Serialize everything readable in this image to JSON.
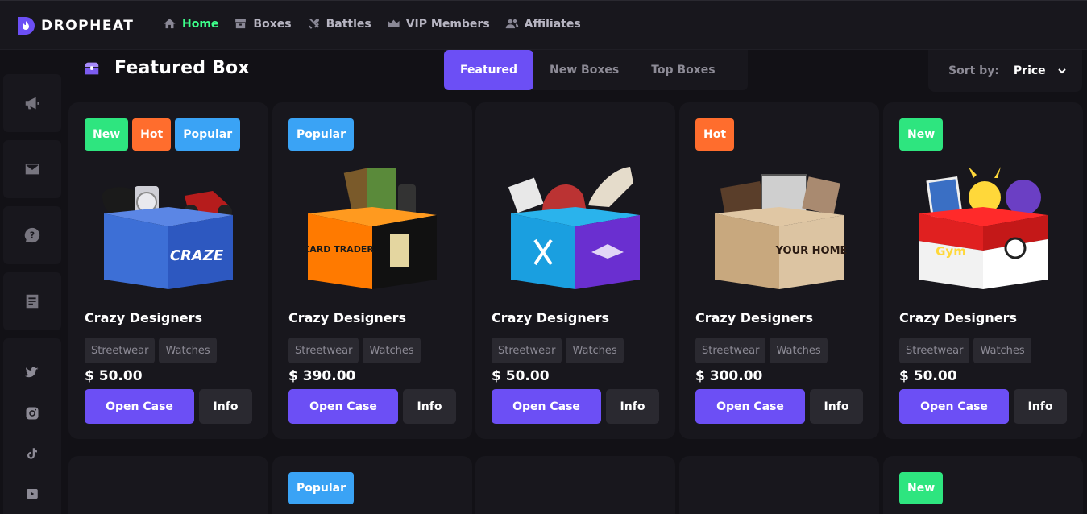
{
  "brand": {
    "name": "DROPHEAT"
  },
  "nav": [
    {
      "label": "Home",
      "icon": "home-icon",
      "active": true
    },
    {
      "label": "Boxes",
      "icon": "boxes-icon",
      "active": false
    },
    {
      "label": "Battles",
      "icon": "swords-icon",
      "active": false
    },
    {
      "label": "VIP Members",
      "icon": "crown-icon",
      "active": false
    },
    {
      "label": "Affiliates",
      "icon": "users-icon",
      "active": false
    }
  ],
  "sidebar": {
    "buttons": [
      "megaphone-icon",
      "mail-icon",
      "help-icon",
      "document-icon"
    ],
    "social": [
      "twitter-icon",
      "instagram-icon",
      "tiktok-icon",
      "youtube-icon"
    ]
  },
  "section": {
    "title": "Featured Box"
  },
  "tabs": [
    {
      "label": "Featured",
      "active": true
    },
    {
      "label": "New Boxes",
      "active": false
    },
    {
      "label": "Top Boxes",
      "active": false
    }
  ],
  "sort": {
    "label": "Sort by:",
    "value": "Price"
  },
  "cards": [
    {
      "badges": [
        "New",
        "Hot",
        "Popular"
      ],
      "name": "Crazy Designers",
      "tags": [
        "Streetwear",
        "Watches"
      ],
      "price": "$ 50.00",
      "open_label": "Open Case",
      "info_label": "Info",
      "box_color": "#3d6fd6",
      "box_text": "CRAZE"
    },
    {
      "badges": [
        "Popular"
      ],
      "name": "Crazy Designers",
      "tags": [
        "Streetwear",
        "Watches"
      ],
      "price": "$ 390.00",
      "open_label": "Open Case",
      "info_label": "Info",
      "box_color": "#111111",
      "box_text": "CARD TRADER"
    },
    {
      "badges": [],
      "name": "Crazy Designers",
      "tags": [
        "Streetwear",
        "Watches"
      ],
      "price": "$ 50.00",
      "open_label": "Open Case",
      "info_label": "Info",
      "box_color": "#6a2fd0",
      "box_text": ""
    },
    {
      "badges": [
        "Hot"
      ],
      "name": "Crazy Designers",
      "tags": [
        "Streetwear",
        "Watches"
      ],
      "price": "$ 300.00",
      "open_label": "Open Case",
      "info_label": "Info",
      "box_color": "#c8a87e",
      "box_text": "YOUR HOME"
    },
    {
      "badges": [
        "New"
      ],
      "name": "Crazy Designers",
      "tags": [
        "Streetwear",
        "Watches"
      ],
      "price": "$ 50.00",
      "open_label": "Open Case",
      "info_label": "Info",
      "box_color": "#e02020",
      "box_text": "Gym"
    }
  ],
  "row2_badges": [
    [],
    [
      "Popular"
    ],
    [],
    [],
    [
      "New"
    ]
  ],
  "colors": {
    "accent": "#6c4ff5",
    "active_nav": "#3dff8a",
    "badge_new": "#2ee57f",
    "badge_hot": "#ff6d2d",
    "badge_popular": "#3aa3f5"
  }
}
